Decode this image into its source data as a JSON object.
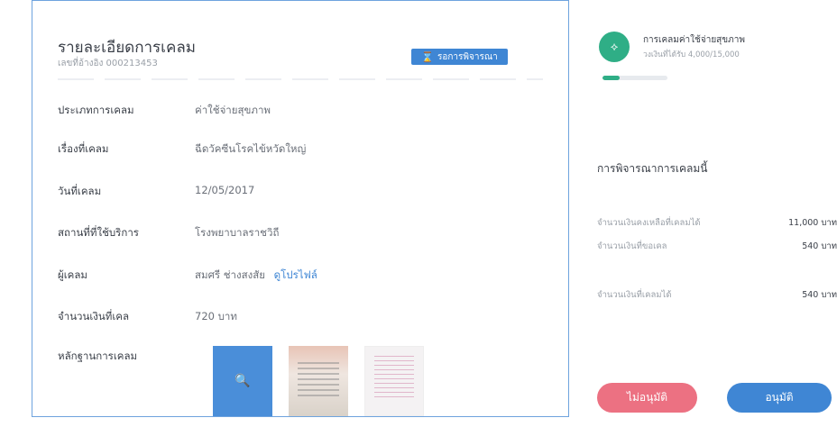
{
  "detail": {
    "title": "รายละเอียดการเคลม",
    "reference": "เลขที่อ้างอิง 000213453",
    "status": "รอการพิจารณา",
    "rows": [
      {
        "label": "ประเภทการเคลม",
        "value": "ค่าใช้จ่ายสุขภาพ"
      },
      {
        "label": "เรื่องที่เคลม",
        "value": "ฉีดวัคซีนโรคไข้หวัดใหญ่"
      },
      {
        "label": "วันที่เคลม",
        "value": "12/05/2017"
      },
      {
        "label": "สถานที่ที่ใช้บริการ",
        "value": "โรงพยาบาลราชวิถี"
      },
      {
        "label": "ผู้เคลม",
        "value": "สมศรี ช่างสงสัย",
        "link": "ดูโปรไฟล์"
      },
      {
        "label": "จำนวนเงินที่เคล",
        "value": "720 บาท"
      },
      {
        "label": "หลักฐานการเคลม",
        "value": ""
      }
    ],
    "evidence_icon": "zoom-icon"
  },
  "summary": {
    "claim_type": "การเคลมค่าใช้จ่ายสุขภาพ",
    "budget": "วงเงินที่ได้รับ 4,000/15,000",
    "progress": 0.27,
    "icon": "dumbbell-icon",
    "heading": "การพิจารณาการเคลมนี้",
    "rows": [
      {
        "label": "จำนวนเงินคงเหลือที่เคลมได้",
        "amount": "11,000 บาท"
      },
      {
        "label": "จำนวนเงินที่ขอเคล",
        "amount": "540 บาท"
      },
      {
        "label": "จำนวนเงินที่เคลมได้",
        "amount": "540 บาท"
      }
    ]
  },
  "actions": {
    "reject": "ไม่อนุมัติ",
    "approve": "อนุมัติ"
  },
  "colors": {
    "accent": "#3f86d4",
    "reject": "#ec7182",
    "progress": "#2fae86"
  }
}
